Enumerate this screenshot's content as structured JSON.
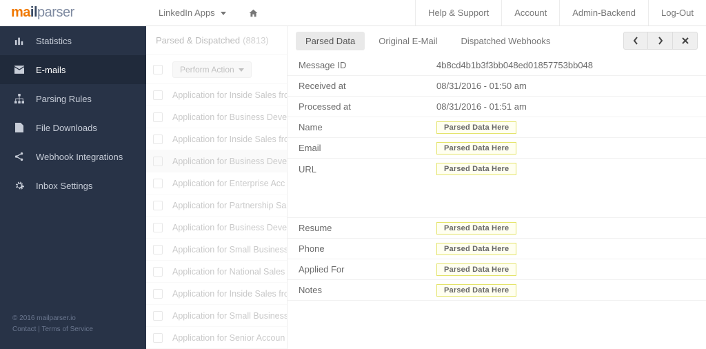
{
  "brand": {
    "part1": "ma",
    "part2": "il",
    "part3": "parser"
  },
  "topnav": {
    "dropdown": "LinkedIn Apps",
    "right": [
      "Help & Support",
      "Account",
      "Admin-Backend",
      "Log-Out"
    ]
  },
  "sidebar": {
    "items": [
      {
        "label": "Statistics"
      },
      {
        "label": "E-mails",
        "active": true
      },
      {
        "label": "Parsing Rules"
      },
      {
        "label": "File Downloads"
      },
      {
        "label": "Webhook Integrations"
      },
      {
        "label": "Inbox Settings"
      }
    ],
    "footer_copyright": "© 2016 mailparser.io",
    "footer_contact": "Contact",
    "footer_sep": " | ",
    "footer_tos": "Terms of Service"
  },
  "list": {
    "header_label": "Parsed & Dispatched",
    "header_count": "(8813)",
    "action_label": "Perform Action",
    "rows": [
      "Application for Inside Sales fro",
      "Application for Business Deve",
      "Application for Inside Sales fro",
      "Application for Business Deve",
      "Application for Enterprise Acc",
      "Application for Partnership Sa",
      "Application for Business Deve",
      "Application for Small Business",
      "Application for National Sales",
      "Application for Inside Sales fro",
      "Application for Small Business",
      "Application for Senior Accoun"
    ],
    "selected_index": 3
  },
  "detail": {
    "tabs": [
      "Parsed Data",
      "Original E-Mail",
      "Dispatched Webhooks"
    ],
    "active_tab": 0,
    "fields_plain": [
      {
        "label": "Message ID",
        "value": "4b8cd4b1b3f3bb048ed01857753bb048"
      },
      {
        "label": "Received at",
        "value": "08/31/2016 - 01:50 am"
      },
      {
        "label": "Processed at",
        "value": "08/31/2016 - 01:51 am"
      }
    ],
    "placeholder_text": "Parsed Data Here",
    "fields_ph_set1": [
      {
        "label": "Name"
      },
      {
        "label": "Email"
      },
      {
        "label": "URL"
      }
    ],
    "fields_ph_set2": [
      {
        "label": "Resume"
      },
      {
        "label": "Phone"
      },
      {
        "label": "Applied For"
      },
      {
        "label": "Notes"
      }
    ]
  }
}
